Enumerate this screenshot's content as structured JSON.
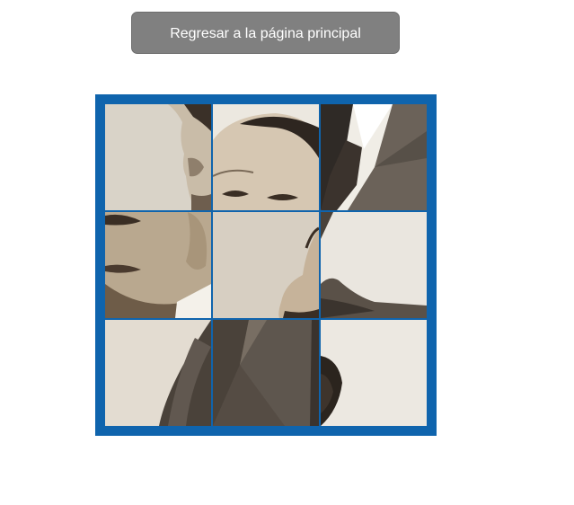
{
  "header": {
    "back_button_label": "Regresar a la página principal"
  },
  "puzzle": {
    "board_color": "#0f64ad",
    "rows": 3,
    "cols": 3,
    "tiles": [
      {
        "id": "t1",
        "content": "ear-and-cheek"
      },
      {
        "id": "t2",
        "content": "forehead-and-eyes"
      },
      {
        "id": "t3",
        "content": "collar-and-tie"
      },
      {
        "id": "t4",
        "content": "nose-and-mouth"
      },
      {
        "id": "t5",
        "content": "chin-edge"
      },
      {
        "id": "t6",
        "content": "lapel-and-background"
      },
      {
        "id": "t7",
        "content": "shoulder"
      },
      {
        "id": "t8",
        "content": "jacket-chest"
      },
      {
        "id": "t9",
        "content": "background-and-hair"
      }
    ]
  }
}
